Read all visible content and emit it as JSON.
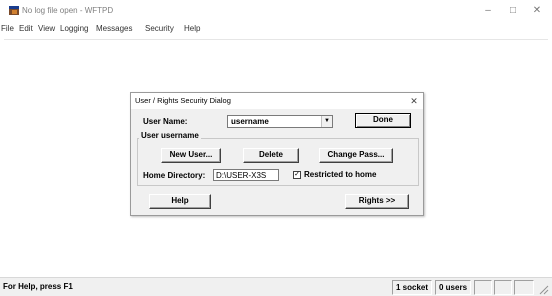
{
  "window": {
    "title": "No log file open - WFTPD",
    "minimize": "–",
    "maximize": "□",
    "close": "✕"
  },
  "menu": [
    "File",
    "Edit",
    "View",
    "Logging",
    "Messages",
    "Security",
    "Help"
  ],
  "dialog": {
    "title": "User / Rights Security Dialog",
    "close": "✕",
    "user_name_label": "User Name:",
    "user_name_value": "username",
    "done_label": "Done",
    "group_label": "User username",
    "new_user_label": "New User...",
    "delete_label": "Delete",
    "change_pass_label": "Change Pass...",
    "home_dir_label": "Home Directory:",
    "home_dir_value": "D:\\USER-X3S",
    "restricted_label": "Restricted to home",
    "restricted_checked": true,
    "checkmark": "✓",
    "help_label": "Help",
    "rights_label": "Rights >>",
    "dropdown_arrow": "▼"
  },
  "status": {
    "help_text": "For Help, press F1",
    "sockets": "1 socket",
    "users": "0 users"
  },
  "icons": {
    "app": "wftpd-app-icon",
    "dropdown": "chevron-down-icon",
    "grip": "resize-grip-icon"
  }
}
